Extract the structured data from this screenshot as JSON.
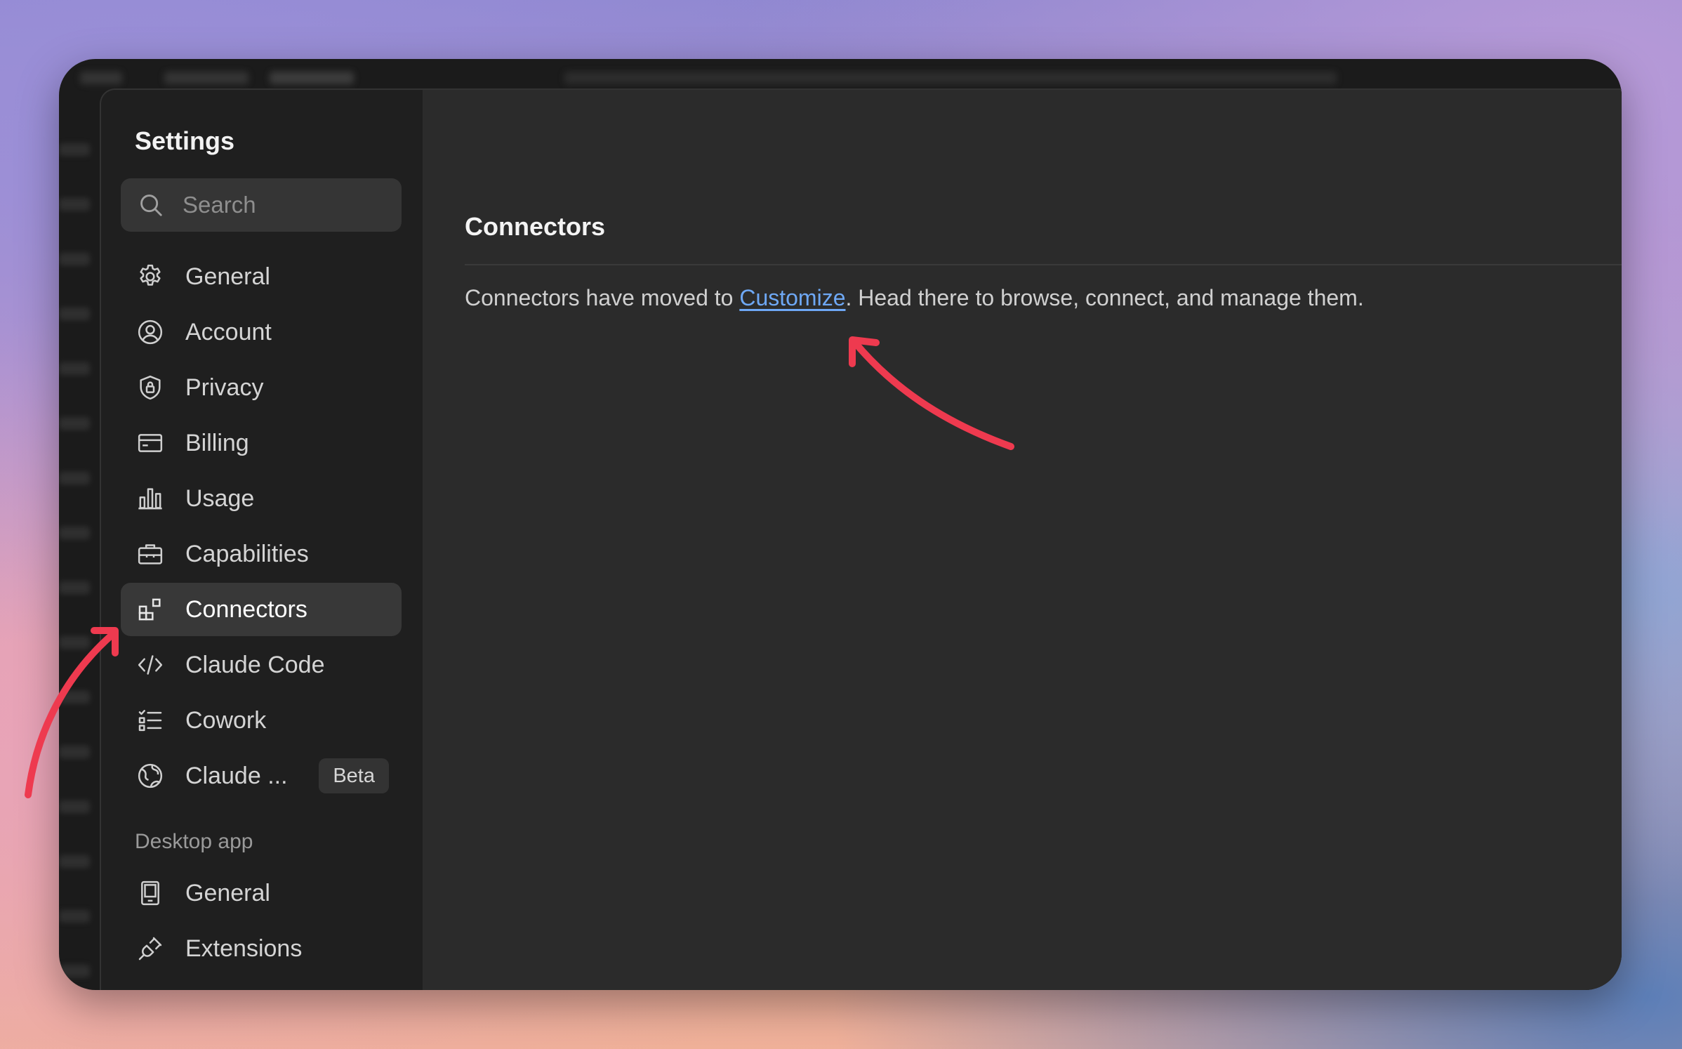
{
  "settings": {
    "title": "Settings",
    "search_placeholder": "Search"
  },
  "nav": {
    "items": [
      {
        "label": "General",
        "icon": "gear-icon"
      },
      {
        "label": "Account",
        "icon": "user-circle-icon"
      },
      {
        "label": "Privacy",
        "icon": "shield-lock-icon"
      },
      {
        "label": "Billing",
        "icon": "credit-card-icon"
      },
      {
        "label": "Usage",
        "icon": "bar-chart-icon"
      },
      {
        "label": "Capabilities",
        "icon": "briefcase-icon"
      },
      {
        "label": "Connectors",
        "icon": "connectors-icon",
        "active": true
      },
      {
        "label": "Claude Code",
        "icon": "code-icon"
      },
      {
        "label": "Cowork",
        "icon": "checklist-icon"
      },
      {
        "label": "Claude ...",
        "icon": "globe-icon",
        "badge": "Beta"
      }
    ]
  },
  "desktop": {
    "section_label": "Desktop app",
    "items": [
      {
        "label": "General",
        "icon": "device-icon"
      },
      {
        "label": "Extensions",
        "icon": "plug-icon"
      }
    ]
  },
  "content": {
    "title": "Connectors",
    "text_before": "Connectors have moved to ",
    "link": "Customize",
    "text_after": ". Head there to browse, connect, and manage them."
  },
  "colors": {
    "accent_link": "#6ea8f5",
    "annotation_arrow": "#ee3a4f"
  }
}
